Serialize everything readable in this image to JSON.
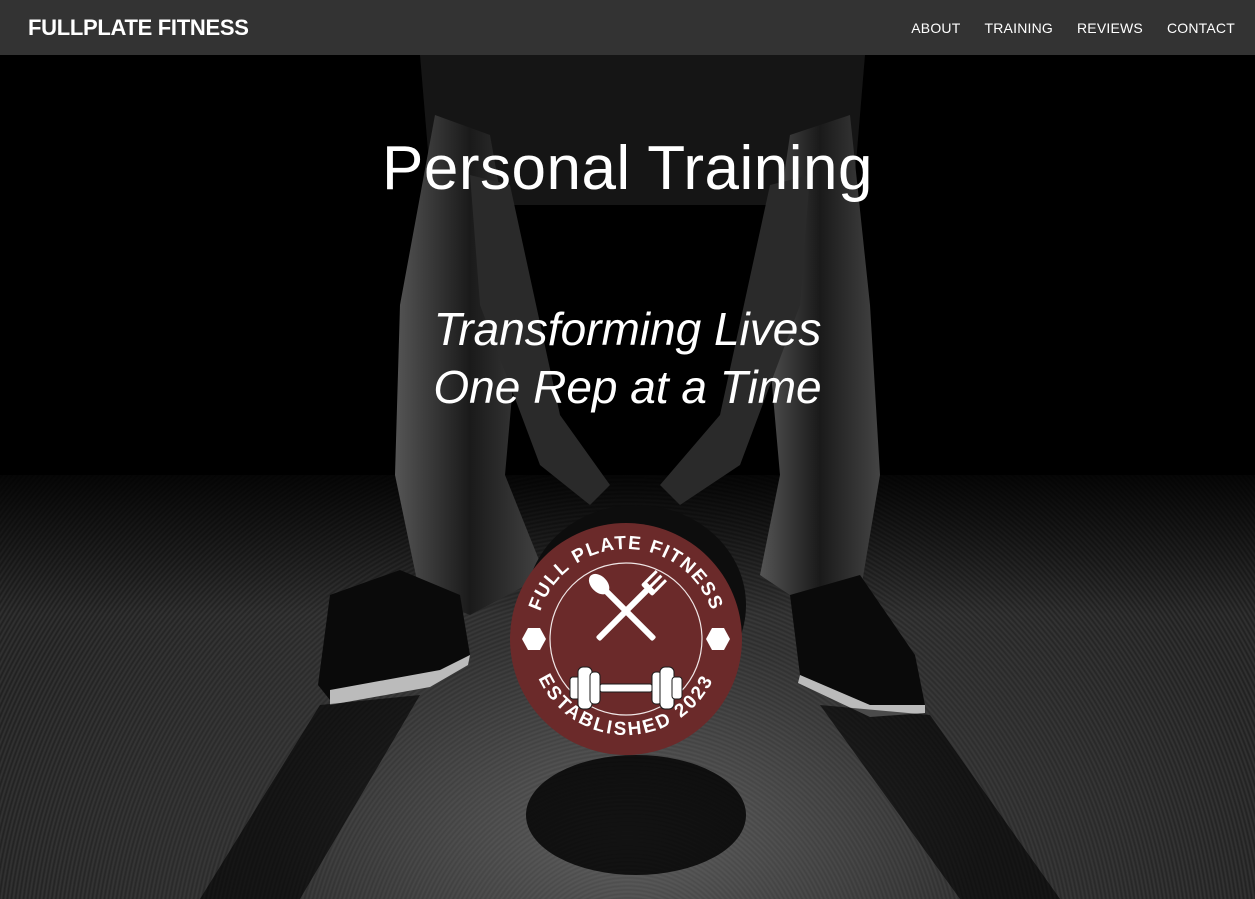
{
  "brand": "FULLPLATE FITNESS",
  "nav": {
    "items": [
      "ABOUT",
      "TRAINING",
      "REVIEWS",
      "CONTACT"
    ]
  },
  "hero": {
    "title": "Personal Training",
    "tagline_line1": "Transforming Lives",
    "tagline_line2": "One Rep at a Time"
  },
  "badge": {
    "top_text": "FULL PLATE FITNESS",
    "bottom_text": "ESTABLISHED 2023",
    "color": "#6b2a2a"
  },
  "colors": {
    "navbar": "#333333",
    "text": "#ffffff"
  }
}
